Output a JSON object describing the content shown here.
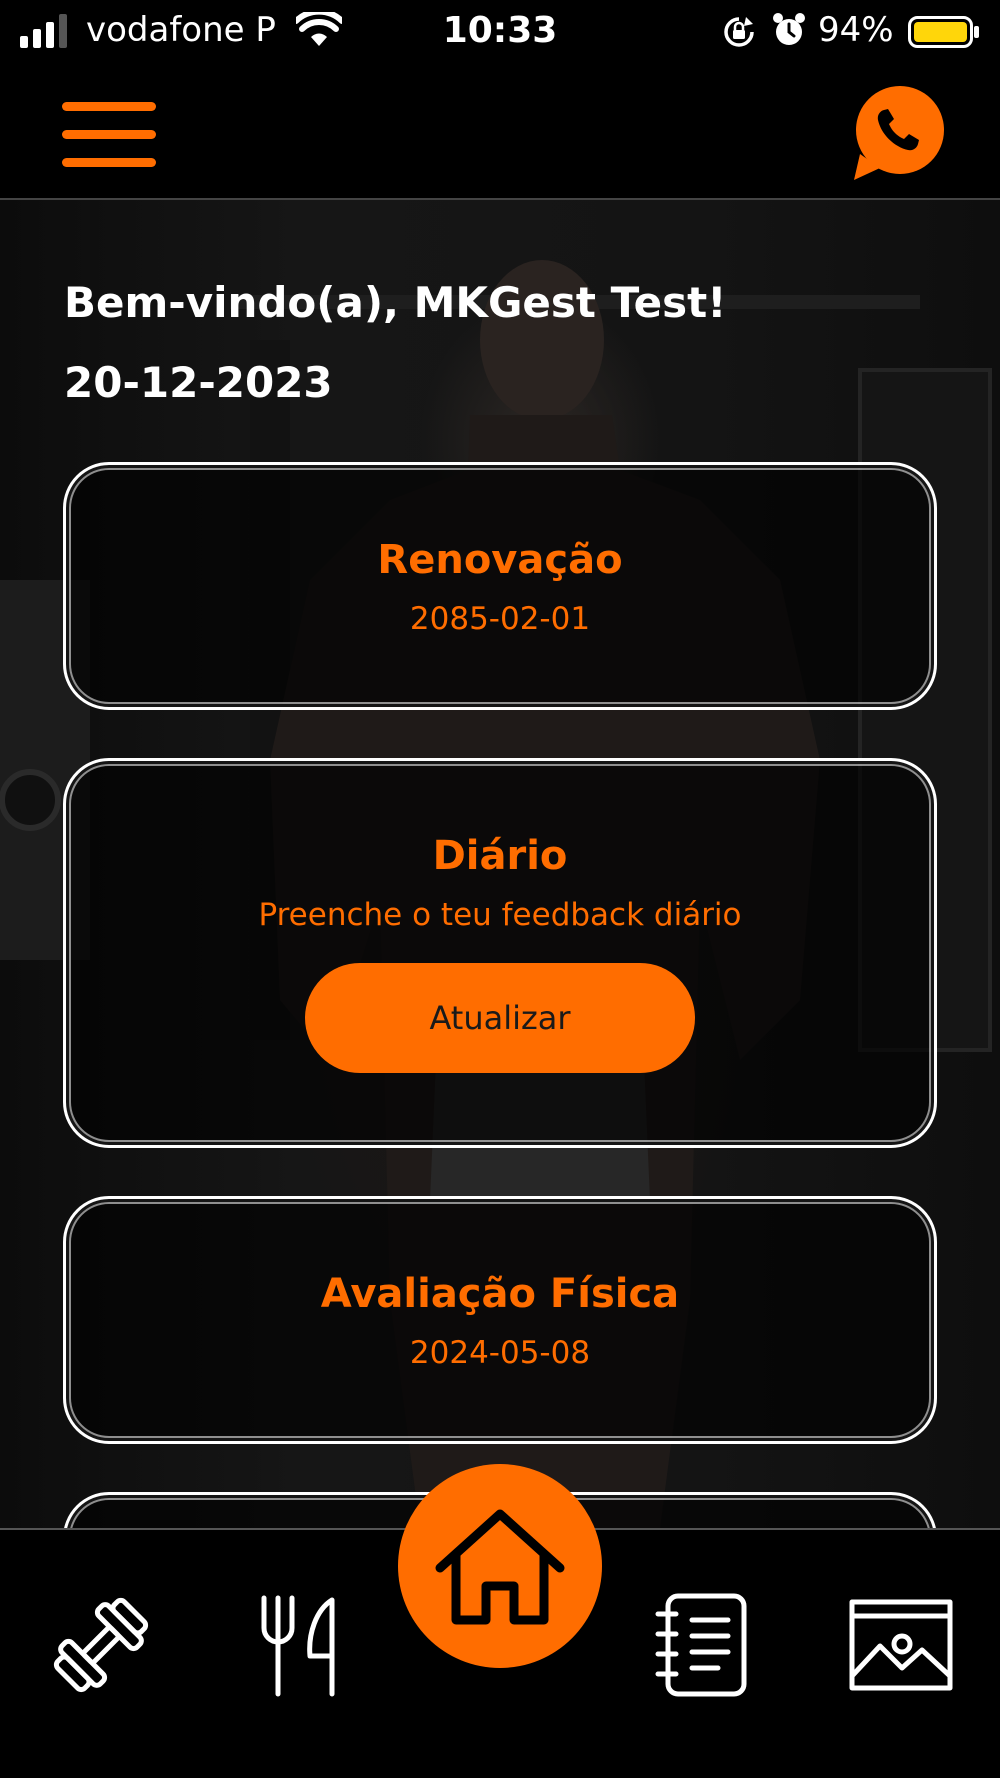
{
  "status_bar": {
    "carrier": "vodafone P",
    "time": "10:33",
    "battery": "94%"
  },
  "header": {
    "menu_icon": "hamburger-menu-icon",
    "contact_icon": "whatsapp-phone-icon"
  },
  "welcome": {
    "greeting": "Bem-vindo(a), MKGest Test!",
    "date": "20-12-2023"
  },
  "cards": {
    "renovacao": {
      "title": "Renovação",
      "value": "2085-02-01"
    },
    "diario": {
      "title": "Diário",
      "subtitle": "Preenche o teu feedback diário",
      "button": "Atualizar"
    },
    "avaliacao": {
      "title": "Avaliação Física",
      "value": "2024-05-08"
    }
  },
  "bottom_nav": {
    "items": [
      {
        "icon": "dumbbell-icon"
      },
      {
        "icon": "fork-knife-icon"
      },
      {
        "icon": "home-icon",
        "active": true
      },
      {
        "icon": "notebook-icon"
      },
      {
        "icon": "gallery-image-icon"
      }
    ]
  },
  "colors": {
    "accent": "#ff6d00",
    "background": "#000000",
    "text": "#ffffff",
    "battery": "#ffd60a"
  }
}
